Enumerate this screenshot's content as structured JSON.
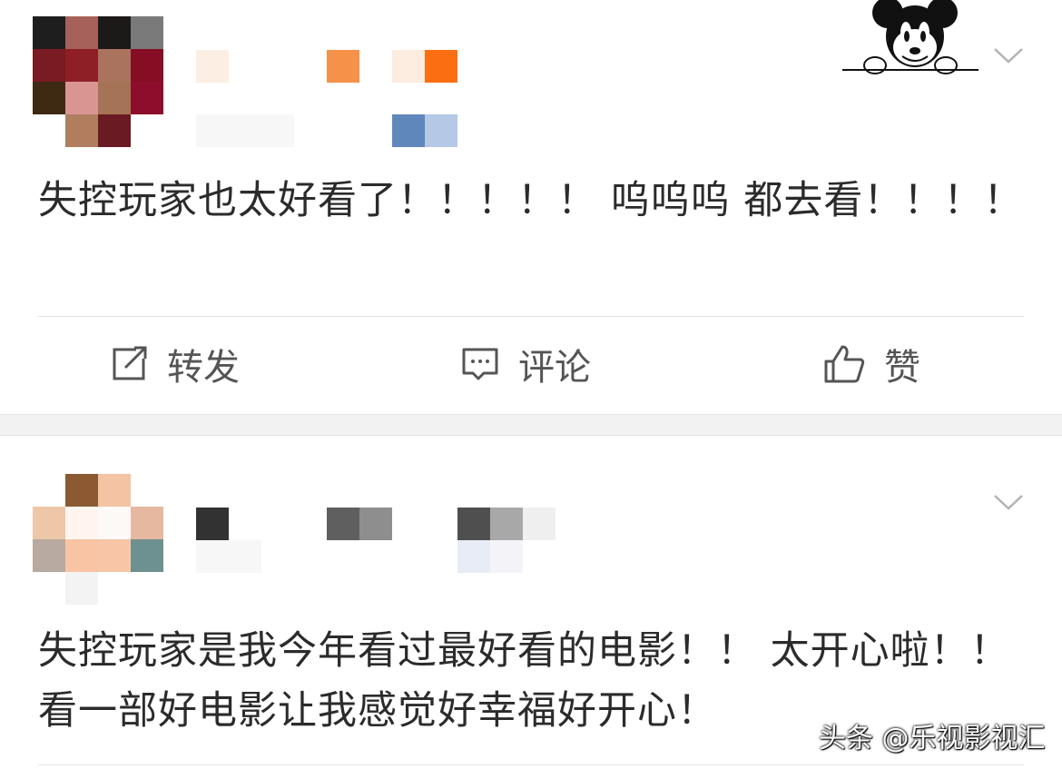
{
  "posts": [
    {
      "text": "失控玩家也太好看了！！！！！ 呜呜呜 都去看！！！！"
    },
    {
      "text": "失控玩家是我今年看过最好看的电影！！ 太开心啦！！ 看一部好电影让我感觉好幸福好开心！"
    }
  ],
  "actions": {
    "repost_label": "转发",
    "comment_label": "评论",
    "like_label": "赞"
  },
  "watermark": "头条 @乐视影视汇",
  "icons": {
    "repost": "share-edit-icon",
    "comment": "comment-bubble-icon",
    "like": "thumbs-up-icon",
    "menu": "chevron-down-icon"
  },
  "colors": {
    "text": "#2b2b2b",
    "action_text": "#555555",
    "separator": "#f2f2f2"
  }
}
